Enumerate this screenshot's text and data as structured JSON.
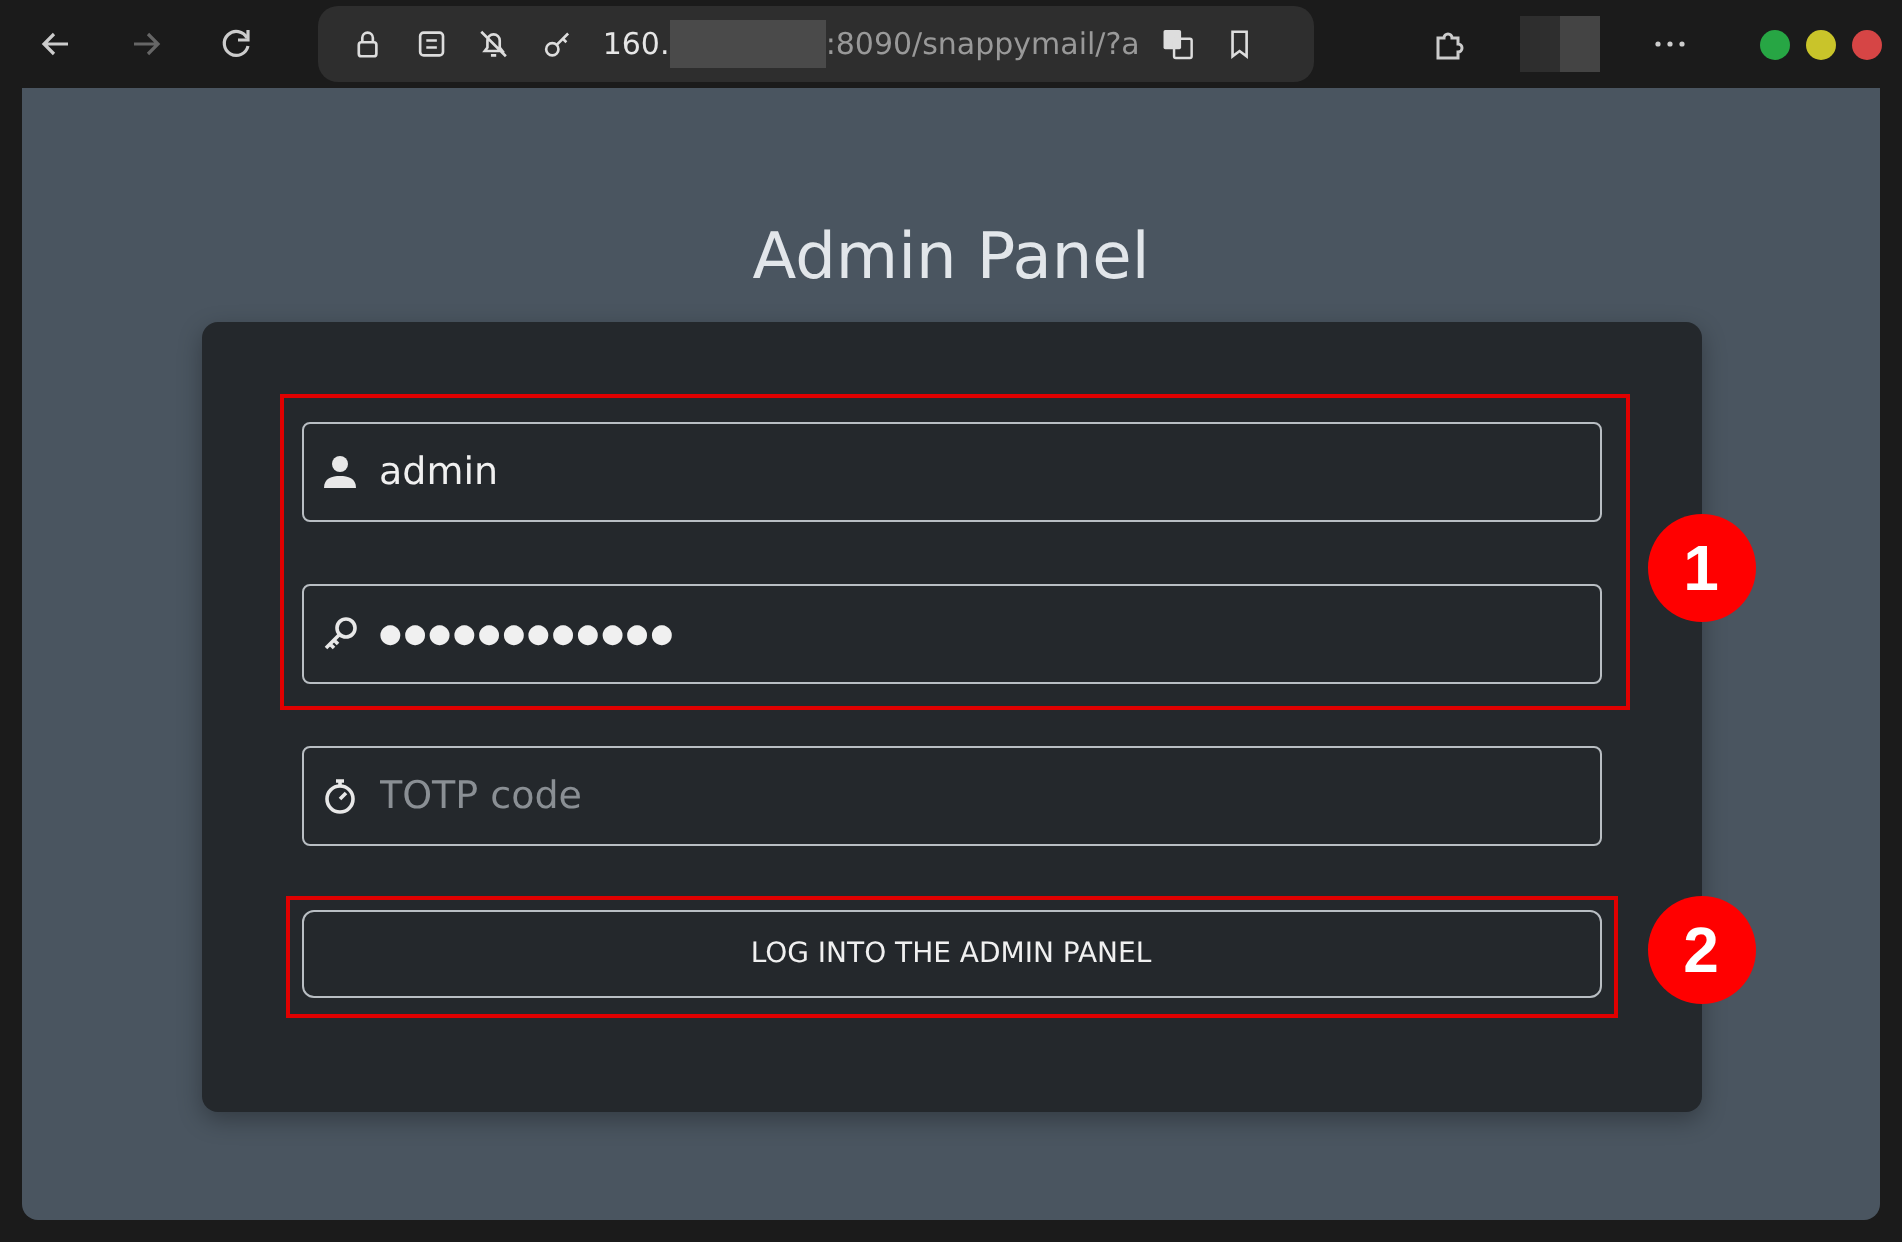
{
  "browser": {
    "url_start": "160.",
    "url_end": ":8090/snappymail/?a",
    "back_disabled": false,
    "forward_disabled": true
  },
  "page": {
    "title": "Admin Panel",
    "fields": [
      {
        "kind": "user",
        "value": "admin"
      },
      {
        "kind": "password",
        "value": "●●●●●●●●●●●●"
      },
      {
        "kind": "totp",
        "placeholder": "TOTP code"
      }
    ],
    "button": "LOG INTO THE ADMIN PANEL",
    "fields_badge": "1",
    "button_badge": "2"
  }
}
